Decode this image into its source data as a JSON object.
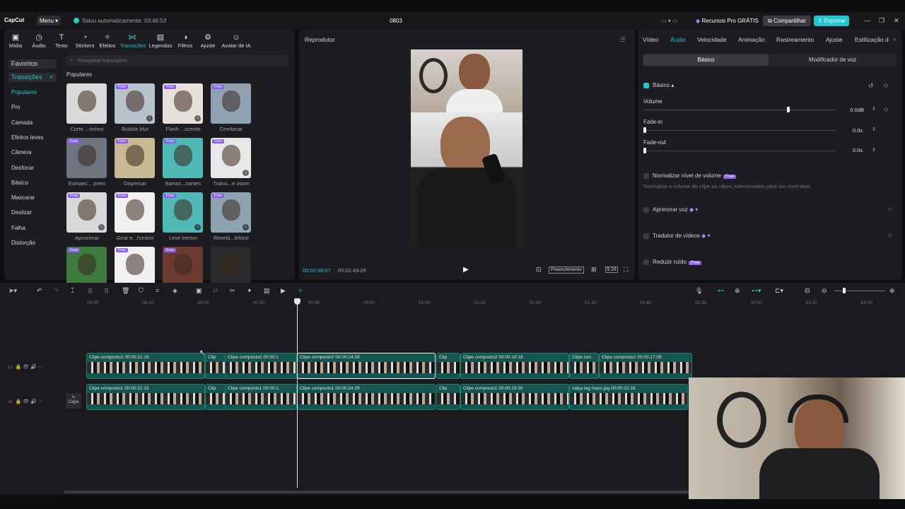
{
  "app": {
    "logo": "CapCut",
    "menu_label": "Menu ▾",
    "autosave": "Salvo automaticamente: 03:46:53",
    "project_name": "0803",
    "pro_resources": "Recursos Pro GRÁTIS",
    "share": "Compartilhar",
    "export": "Exportar"
  },
  "toolbar": [
    {
      "label": "Mídia",
      "icon": "media-icon"
    },
    {
      "label": "Áudio",
      "icon": "audio-icon"
    },
    {
      "label": "Texto",
      "icon": "text-icon"
    },
    {
      "label": "Stickers",
      "icon": "sticker-icon"
    },
    {
      "label": "Efeitos",
      "icon": "effects-icon"
    },
    {
      "label": "Transições",
      "icon": "transition-icon"
    },
    {
      "label": "Legendas",
      "icon": "captions-icon"
    },
    {
      "label": "Filtros",
      "icon": "filter-icon"
    },
    {
      "label": "Ajuste",
      "icon": "adjust-icon"
    },
    {
      "label": "Avatar de IA",
      "icon": "avatar-icon"
    }
  ],
  "sidebar": {
    "favorites": "Favoritos",
    "transitions": "Transições",
    "items": [
      "Populares",
      "Pro",
      "Camada",
      "Efeitos leves",
      "Câmera",
      "Desfocar",
      "Básico",
      "Mascarar",
      "Deslizar",
      "Falha",
      "Distorção"
    ]
  },
  "search": {
    "placeholder": "Pesquisar transições"
  },
  "section_title": "Populares",
  "free_badge": "Free",
  "transitions": [
    {
      "label": "Corte ...rinhos",
      "free": false,
      "dl": false,
      "color": "#d9d9d9"
    },
    {
      "label": "Bubble blur",
      "free": true,
      "dl": true,
      "color": "#b8c2cc"
    },
    {
      "label": "Flash ...scente",
      "free": true,
      "dl": true,
      "color": "#e6e1dc"
    },
    {
      "label": "Combinar",
      "free": true,
      "dl": false,
      "color": "#8fa3b3"
    },
    {
      "label": "Esmaec... preto",
      "free": true,
      "dl": false,
      "color": "#6c7480"
    },
    {
      "label": "Dispersar",
      "free": true,
      "dl": false,
      "color": "#c9b894"
    },
    {
      "label": "Barras...zantes",
      "free": true,
      "dl": false,
      "color": "#4fb7b4"
    },
    {
      "label": "Transi...e zoom",
      "free": true,
      "dl": true,
      "color": "#e8e8e8"
    },
    {
      "label": "Aproximar",
      "free": true,
      "dl": true,
      "color": "#d8d8d8"
    },
    {
      "label": "Girar e...horário",
      "free": true,
      "dl": false,
      "color": "#f0f0f0"
    },
    {
      "label": "Leve tremor",
      "free": true,
      "dl": true,
      "color": "#4fb7b4"
    },
    {
      "label": "Revela...lefone",
      "free": true,
      "dl": true,
      "color": "#8fa3b3"
    },
    {
      "label": "",
      "free": true,
      "dl": false,
      "color": "#3d7a3d"
    },
    {
      "label": "",
      "free": true,
      "dl": false,
      "color": "#f0f0f0"
    },
    {
      "label": "",
      "free": true,
      "dl": false,
      "color": "#6b3a30"
    },
    {
      "label": "",
      "free": false,
      "dl": false,
      "color": "#2a2a2a"
    }
  ],
  "player": {
    "title": "Reprodutor",
    "current": "00:00:38:07",
    "total": "00:01:49:29",
    "fill": "Preenchimento",
    "ratio": "9:16"
  },
  "inspector": {
    "tabs": [
      "Vídeo",
      "Áudio",
      "Velocidade",
      "Animação",
      "Rastreamento",
      "Ajuste",
      "Estilização d"
    ],
    "active_tab": "Áudio",
    "subtabs": [
      "Básico",
      "Modificador de voz"
    ],
    "basic": "Básico ▴",
    "volume": {
      "label": "Volume",
      "value": "0.0dB",
      "level": 0.75
    },
    "fade_in": {
      "label": "Fade-in",
      "value": "0.0s",
      "level": 0
    },
    "fade_out": {
      "label": "Fade-out",
      "value": "0.0s",
      "level": 0
    },
    "normalize": {
      "label": "Normalizar nível de volume",
      "desc": "Normalize o volume do clipe ou clipes selecionados para um nível-alvo."
    },
    "enhance": "Aprimorar voz",
    "translator": "Tradutor de vídeos",
    "noise": "Reduzir ruído"
  },
  "timeline": {
    "ruler": [
      "00:00",
      "00:10",
      "00:20",
      "00:30",
      "00:40",
      "00:50",
      "01:00",
      "01:10",
      "01:20",
      "01:30",
      "01:40",
      "01:50",
      "02:00",
      "02:10",
      "02:20"
    ],
    "cover_label": "Capa",
    "track1": [
      {
        "title": "Clipe composto2  00:00:21:15"
      },
      {
        "title": "Clip"
      },
      {
        "title": "Clipe composto2  00:00:1"
      },
      {
        "title": "Clipe composto2  00:00:24:29"
      },
      {
        "title": "Clip"
      },
      {
        "title": "Clipe composto2  00:00:19:18"
      },
      {
        "title": "Clipe con"
      },
      {
        "title": "Clipe composto2  00:00:17:08"
      }
    ],
    "track2": [
      {
        "title": "Clipe composto1  00:00:21:15"
      },
      {
        "title": "Clip"
      },
      {
        "title": "Clipe composto1  00:00:1"
      },
      {
        "title": "Clipe composto1  00:00:24:29"
      },
      {
        "title": "Clip"
      },
      {
        "title": "Clipe composto1  00:00:19:20"
      },
      {
        "title": "calça leg masc.jpg  00:00:22:18"
      }
    ]
  }
}
